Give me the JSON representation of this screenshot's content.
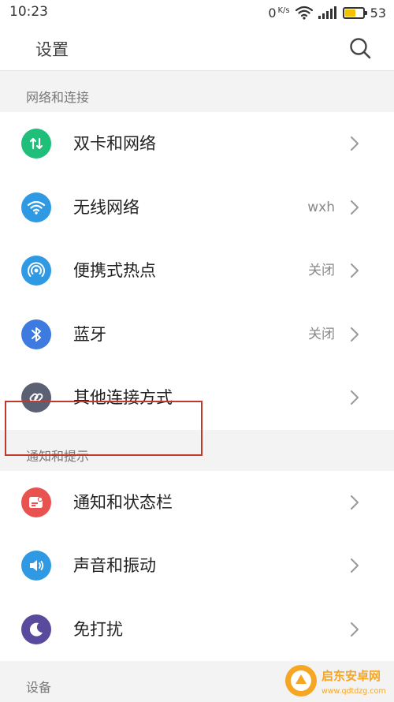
{
  "status_bar": {
    "time": "10:23",
    "net_speed": "0",
    "net_speed_unit": "K/s",
    "battery": "53",
    "battery_fraction": 0.53,
    "battery_color": "#f2c200"
  },
  "header": {
    "title": "设置",
    "search_icon": "search-icon"
  },
  "sections": [
    {
      "title": "网络和连接",
      "items": [
        {
          "label": "双卡和网络",
          "value": "",
          "icon": "dual-sim-icon",
          "color": "#1fbf7a"
        },
        {
          "label": "无线网络",
          "value": "wxh",
          "icon": "wifi-icon",
          "color": "#2f9ae3"
        },
        {
          "label": "便携式热点",
          "value": "关闭",
          "icon": "hotspot-icon",
          "color": "#2f9ae3"
        },
        {
          "label": "蓝牙",
          "value": "关闭",
          "icon": "bluetooth-icon",
          "color": "#3e7be0"
        },
        {
          "label": "其他连接方式",
          "value": "",
          "icon": "link-icon",
          "color": "#5b6173"
        }
      ]
    },
    {
      "title": "通知和提示",
      "items": [
        {
          "label": "通知和状态栏",
          "value": "",
          "icon": "notification-icon",
          "color": "#e8534f"
        },
        {
          "label": "声音和振动",
          "value": "",
          "icon": "sound-icon",
          "color": "#2f9ae3"
        },
        {
          "label": "免打扰",
          "value": "",
          "icon": "moon-icon",
          "color": "#5a4a9e"
        }
      ]
    },
    {
      "title": "设备",
      "items": []
    }
  ],
  "watermark": {
    "text_main": "启东安卓网",
    "text_url": "www.qdtdzg.com"
  }
}
